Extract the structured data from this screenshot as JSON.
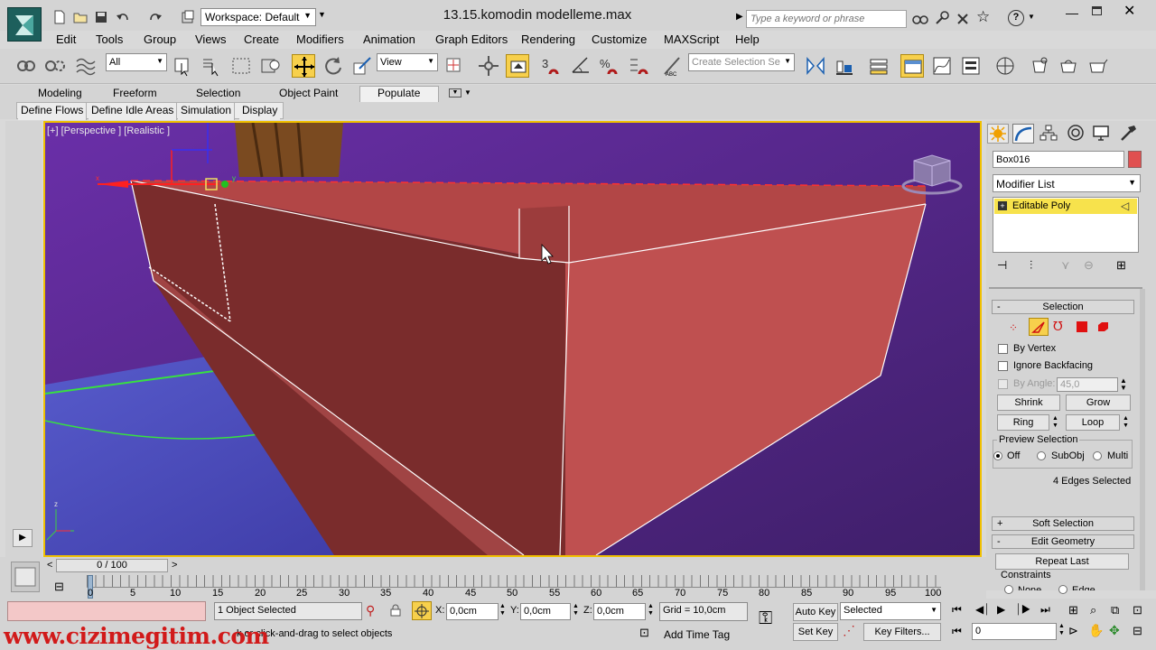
{
  "window": {
    "title": "13.15.komodin modelleme.max",
    "workspace": "Workspace: Default"
  },
  "search": {
    "placeholder": "Type a keyword or phrase"
  },
  "menu": [
    "Edit",
    "Tools",
    "Group",
    "Views",
    "Create",
    "Modifiers",
    "Animation",
    "Graph Editors",
    "Rendering",
    "Customize",
    "MAXScript",
    "Help"
  ],
  "toolbar": {
    "filter": "All",
    "refcoord": "View",
    "named_selection_placeholder": "Create Selection Se"
  },
  "ribbon": {
    "tabs": [
      "Modeling",
      "Freeform",
      "Selection",
      "Object Paint",
      "Populate"
    ],
    "active_tab": "Populate",
    "subtabs": [
      "Define Flows",
      "Define Idle Areas",
      "Simulation",
      "Display"
    ]
  },
  "viewport": {
    "label": "[+] [Perspective ] [Realistic ]"
  },
  "cmdpanel": {
    "object_name": "Box016",
    "object_color": "#e05050",
    "modifier_list": "Modifier List",
    "stack_item": "Editable Poly",
    "selection": {
      "title": "Selection",
      "by_vertex": "By Vertex",
      "ignore_backfacing": "Ignore Backfacing",
      "by_angle": "By Angle:",
      "angle_value": "45,0",
      "shrink": "Shrink",
      "grow": "Grow",
      "ring": "Ring",
      "loop": "Loop",
      "preview_selection": "Preview Selection",
      "off": "Off",
      "subobj": "SubObj",
      "multi": "Multi",
      "status": "4 Edges Selected"
    },
    "soft_selection": "Soft Selection",
    "edit_geometry": "Edit Geometry",
    "repeat_last": "Repeat Last",
    "constraints": "Constraints",
    "none": "None",
    "edge": "Edge"
  },
  "timeline": {
    "slider": "0 / 100",
    "ticks": [
      "0",
      "5",
      "10",
      "15",
      "20",
      "25",
      "30",
      "35",
      "40",
      "45",
      "50",
      "55",
      "60",
      "65",
      "70",
      "75",
      "80",
      "85",
      "90",
      "95",
      "100"
    ]
  },
  "status": {
    "selected": "1 Object Selected",
    "prompt": "k or click-and-drag to select objects",
    "x_label": "X:",
    "x": "0,0cm",
    "y_label": "Y:",
    "y": "0,0cm",
    "z_label": "Z:",
    "z": "0,0cm",
    "grid": "Grid = 10,0cm",
    "auto_key": "Auto Key",
    "set_key": "Set Key",
    "key_mode": "Selected",
    "key_filters": "Key Filters...",
    "add_time_tag": "Add Time Tag",
    "frame": "0"
  },
  "watermark": "www.cizimegitim.com"
}
